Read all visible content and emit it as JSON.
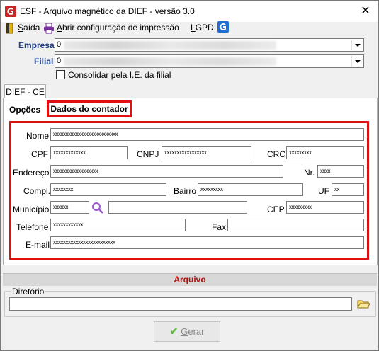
{
  "window": {
    "title": "ESF - Arquivo magnético da DIEF - versão 3.0",
    "close_glyph": "✕"
  },
  "menu": {
    "saida": {
      "prefix": "",
      "mnemonic": "S",
      "rest": "aída"
    },
    "config": {
      "mnemonic": "A",
      "rest": "brir configuração de impressão"
    },
    "lgpd": {
      "prefix": "",
      "mnemonic": "L",
      "rest": "GPD"
    }
  },
  "header": {
    "empresa_label": "Empresa",
    "empresa_value": "0",
    "filial_label": "Filial",
    "filial_value": "0",
    "consolidar_label": "Consolidar pela I.E. da filial",
    "consolidar_checked": false
  },
  "tabs": {
    "outer": "DIEF - CE",
    "opcoes": "Opções",
    "dados_contador": "Dados do contador"
  },
  "form": {
    "nome": {
      "label": "Nome",
      "value": "xxxxxxxxxxxxxxxxxxxxxxxxxx"
    },
    "cpf": {
      "label": "CPF",
      "value": "xxxxxxxxxxxxx"
    },
    "cnpj": {
      "label": "CNPJ",
      "value": "xxxxxxxxxxxxxxxxx"
    },
    "crc": {
      "label": "CRC",
      "value": "xxxxxxxxx"
    },
    "endereco": {
      "label": "Endereço",
      "value": "xxxxxxxxxxxxxxxxxx"
    },
    "nr": {
      "label": "Nr.",
      "value": "xxxx"
    },
    "compl": {
      "label": "Compl.",
      "value": "xxxxxxxx"
    },
    "bairro": {
      "label": "Bairro",
      "value": "xxxxxxxxx"
    },
    "uf": {
      "label": "UF",
      "value": "xx"
    },
    "municipio": {
      "label": "Município",
      "value": "xxxxxx",
      "desc": ""
    },
    "cep": {
      "label": "CEP",
      "value": "xxxxxxxxx"
    },
    "telefone": {
      "label": "Telefone",
      "value": "xxxxxxxxxxxx"
    },
    "fax": {
      "label": "Fax",
      "value": ""
    },
    "email": {
      "label": "E-mail",
      "value": "xxxxxxxxxxxxxxxxxxxxxxxxx"
    }
  },
  "arquivo": {
    "section_title": "Arquivo",
    "diretorio_label": "Diretório",
    "diretorio_value": ""
  },
  "actions": {
    "gerar_mnemonic": "G",
    "gerar_rest": "erar"
  },
  "colors": {
    "highlight_red": "#e01010",
    "section_title_red": "#b01010",
    "label_blue": "#1a3a8a",
    "check_green": "#62b848"
  }
}
